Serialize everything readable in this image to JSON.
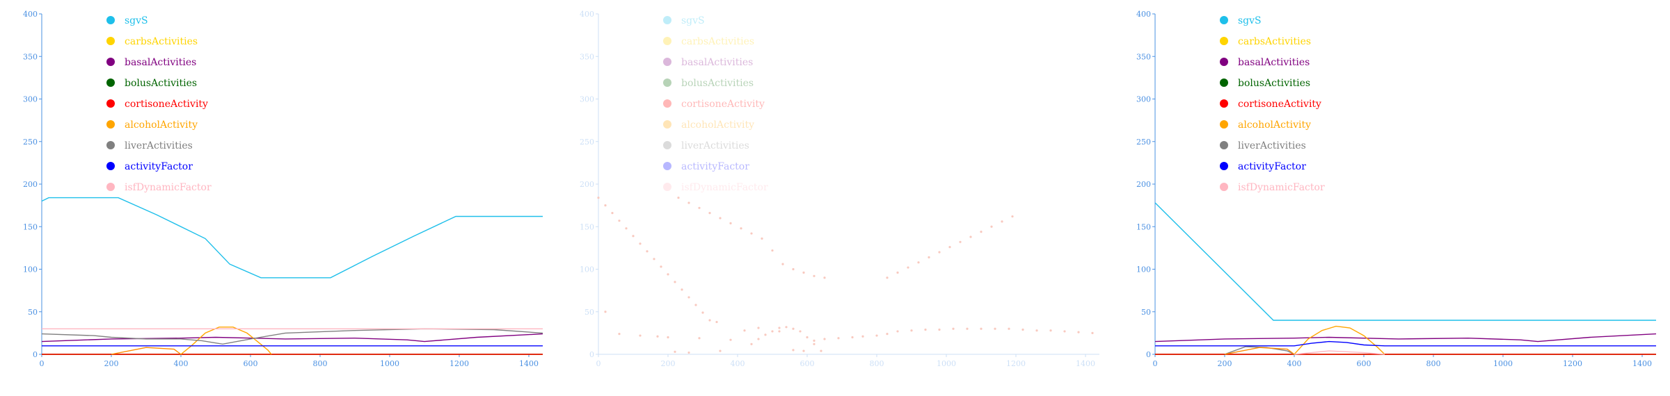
{
  "chart_data": [
    {
      "type": "line",
      "xlim": [
        0,
        1440
      ],
      "ylim": [
        0,
        400
      ],
      "xticks": [
        0,
        200,
        400,
        600,
        800,
        1000,
        1200,
        1400
      ],
      "yticks": [
        0,
        50,
        100,
        150,
        200,
        250,
        300,
        350,
        400
      ],
      "legend_placement": "top-left",
      "faded": false,
      "series": [
        {
          "name": "sgvS",
          "color": "#1ebfea",
          "x": [
            0,
            20,
            220,
            330,
            470,
            540,
            630,
            830,
            950,
            1070,
            1190,
            1440
          ],
          "y": [
            180,
            184,
            184,
            164,
            136,
            106,
            90,
            90,
            115,
            139,
            162,
            162
          ]
        },
        {
          "name": "carbsActivities",
          "color": "#ffd400",
          "x": [
            0,
            1440
          ],
          "y": [
            0,
            0
          ]
        },
        {
          "name": "basalActivities",
          "color": "#800080",
          "x": [
            0,
            200,
            400,
            500,
            700,
            900,
            1050,
            1100,
            1250,
            1440
          ],
          "y": [
            15,
            18,
            19,
            20,
            18,
            19,
            17,
            15,
            20,
            24
          ]
        },
        {
          "name": "bolusActivities",
          "color": "#006400",
          "x": [
            0,
            1440
          ],
          "y": [
            0,
            0
          ]
        },
        {
          "name": "cortisoneActivity",
          "color": "#ff0000",
          "x": [
            0,
            1440
          ],
          "y": [
            0,
            0
          ]
        },
        {
          "name": "alcoholActivity",
          "color": "#ffa500",
          "x": [
            400,
            430,
            470,
            510,
            550,
            590,
            620,
            650,
            660
          ],
          "y": [
            0,
            10,
            25,
            32,
            32,
            25,
            15,
            5,
            0
          ]
        },
        {
          "name": "liverActivities",
          "color": "#808080",
          "x": [
            0,
            150,
            200,
            300,
            400,
            460,
            520,
            600,
            700,
            900,
            1100,
            1300,
            1440
          ],
          "y": [
            24,
            22,
            20,
            18,
            18,
            16,
            12,
            18,
            25,
            28,
            30,
            29,
            25
          ]
        },
        {
          "name": "activityFactor",
          "color": "#0000ff",
          "x": [
            0,
            1440
          ],
          "y": [
            10,
            10
          ]
        },
        {
          "name": "isfDynamicFactor",
          "color": "#ffb6c1",
          "x": [
            0,
            1440
          ],
          "y": [
            30,
            30
          ]
        },
        {
          "name": "",
          "color": "#ff8c00",
          "x": [
            200,
            300,
            380,
            400
          ],
          "y": [
            0,
            8,
            6,
            0
          ]
        }
      ]
    },
    {
      "type": "scatter",
      "xlim": [
        0,
        1440
      ],
      "ylim": [
        0,
        400
      ],
      "xticks": [
        0,
        200,
        400,
        600,
        800,
        1000,
        1200,
        1400
      ],
      "yticks": [
        0,
        50,
        100,
        150,
        200,
        250,
        300,
        350,
        400
      ],
      "legend_placement": "top-left",
      "faded": true,
      "series": [
        {
          "name": "sgvS",
          "color": "#1ebfea",
          "x": [],
          "y": []
        },
        {
          "name": "carbsActivities",
          "color": "#ffd400",
          "x": [],
          "y": []
        },
        {
          "name": "basalActivities",
          "color": "#800080",
          "x": [],
          "y": []
        },
        {
          "name": "bolusActivities",
          "color": "#006400",
          "x": [],
          "y": []
        },
        {
          "name": "cortisoneActivity",
          "color": "#ff0000",
          "x": [],
          "y": []
        },
        {
          "name": "alcoholActivity",
          "color": "#ffa500",
          "x": [],
          "y": []
        },
        {
          "name": "liverActivities",
          "color": "#808080",
          "x": [],
          "y": []
        },
        {
          "name": "activityFactor",
          "color": "#0000ff",
          "x": [],
          "y": []
        },
        {
          "name": "isfDynamicFactor",
          "color": "#ffb6c1",
          "x": [],
          "y": []
        },
        {
          "name": "",
          "color": "#e8401c",
          "x": [
            0,
            20,
            40,
            60,
            80,
            100,
            120,
            140,
            160,
            180,
            200,
            220,
            240,
            260,
            280,
            300,
            320,
            340
          ],
          "y": [
            184,
            175,
            166,
            157,
            148,
            139,
            130,
            121,
            112,
            103,
            94,
            85,
            76,
            67,
            58,
            49,
            40,
            38
          ]
        },
        {
          "name": "",
          "color": "#e8401c",
          "x": [
            230,
            260,
            290,
            320,
            350,
            380,
            410,
            440,
            470,
            500,
            530,
            560,
            590,
            620,
            650
          ],
          "y": [
            184,
            178,
            172,
            166,
            160,
            154,
            148,
            142,
            136,
            122,
            106,
            100,
            96,
            92,
            90
          ]
        },
        {
          "name": "",
          "color": "#e8401c",
          "x": [
            830,
            860,
            890,
            920,
            950,
            980,
            1010,
            1040,
            1070,
            1100,
            1130,
            1160,
            1190
          ],
          "y": [
            90,
            96,
            102,
            108,
            114,
            120,
            126,
            132,
            138,
            144,
            150,
            156,
            162
          ]
        },
        {
          "name": "",
          "color": "#e8401c",
          "x": [
            20,
            60,
            120,
            170,
            200,
            220,
            260,
            290,
            350,
            380,
            420,
            460,
            520,
            560,
            590,
            620,
            650,
            690,
            730,
            760,
            800,
            830,
            860,
            900,
            940,
            980,
            1020,
            1060,
            1100,
            1140,
            1180,
            1220,
            1260,
            1300,
            1340,
            1380,
            1420
          ],
          "y": [
            50,
            24,
            22,
            21,
            20,
            3,
            2,
            19,
            4,
            17,
            28,
            31,
            27,
            5,
            4,
            16,
            18,
            19,
            20,
            21,
            22,
            24,
            27,
            28,
            29,
            29,
            30,
            30,
            30,
            30,
            30,
            29,
            28,
            28,
            27,
            26,
            25
          ]
        },
        {
          "name": "",
          "color": "#e8401c",
          "x": [
            440,
            460,
            480,
            500,
            520,
            540,
            560,
            580,
            600,
            620,
            640
          ],
          "y": [
            12,
            18,
            23,
            27,
            31,
            32,
            30,
            27,
            20,
            12,
            4
          ]
        }
      ]
    },
    {
      "type": "line",
      "xlim": [
        0,
        1440
      ],
      "ylim": [
        0,
        400
      ],
      "xticks": [
        0,
        200,
        400,
        600,
        800,
        1000,
        1200,
        1400
      ],
      "yticks": [
        0,
        50,
        100,
        150,
        200,
        250,
        300,
        350,
        400
      ],
      "legend_placement": "top-left",
      "faded": false,
      "series": [
        {
          "name": "sgvS",
          "color": "#1ebfea",
          "x": [
            0,
            340,
            1440
          ],
          "y": [
            178,
            40,
            40
          ]
        },
        {
          "name": "carbsActivities",
          "color": "#ffd400",
          "x": [
            0,
            1440
          ],
          "y": [
            0,
            0
          ]
        },
        {
          "name": "basalActivities",
          "color": "#800080",
          "x": [
            0,
            200,
            400,
            500,
            700,
            900,
            1050,
            1100,
            1250,
            1440
          ],
          "y": [
            15,
            18,
            19,
            20,
            18,
            19,
            17,
            15,
            20,
            24
          ]
        },
        {
          "name": "bolusActivities",
          "color": "#006400",
          "x": [
            0,
            1440
          ],
          "y": [
            0,
            0
          ]
        },
        {
          "name": "cortisoneActivity",
          "color": "#ff0000",
          "x": [
            0,
            1440
          ],
          "y": [
            0,
            0
          ]
        },
        {
          "name": "alcoholActivity",
          "color": "#ffa500",
          "x": [
            400,
            440,
            480,
            520,
            560,
            600,
            640,
            660
          ],
          "y": [
            0,
            18,
            28,
            33,
            31,
            22,
            8,
            0
          ]
        },
        {
          "name": "liverActivities",
          "color": "#808080",
          "x": [
            200,
            260,
            320,
            380,
            400
          ],
          "y": [
            0,
            9,
            8,
            4,
            0
          ]
        },
        {
          "name": "activityFactor",
          "color": "#0000ff",
          "x": [
            0,
            400,
            450,
            500,
            550,
            600,
            660,
            1440
          ],
          "y": [
            10,
            10,
            13,
            15,
            14,
            11,
            10,
            10
          ]
        },
        {
          "name": "isfDynamicFactor",
          "color": "#ffb6c1",
          "x": [
            400,
            500,
            600,
            660
          ],
          "y": [
            0,
            4,
            2,
            0
          ]
        },
        {
          "name": "",
          "color": "#ff8c00",
          "x": [
            200,
            300,
            380,
            400
          ],
          "y": [
            0,
            8,
            6,
            0
          ]
        }
      ]
    }
  ]
}
